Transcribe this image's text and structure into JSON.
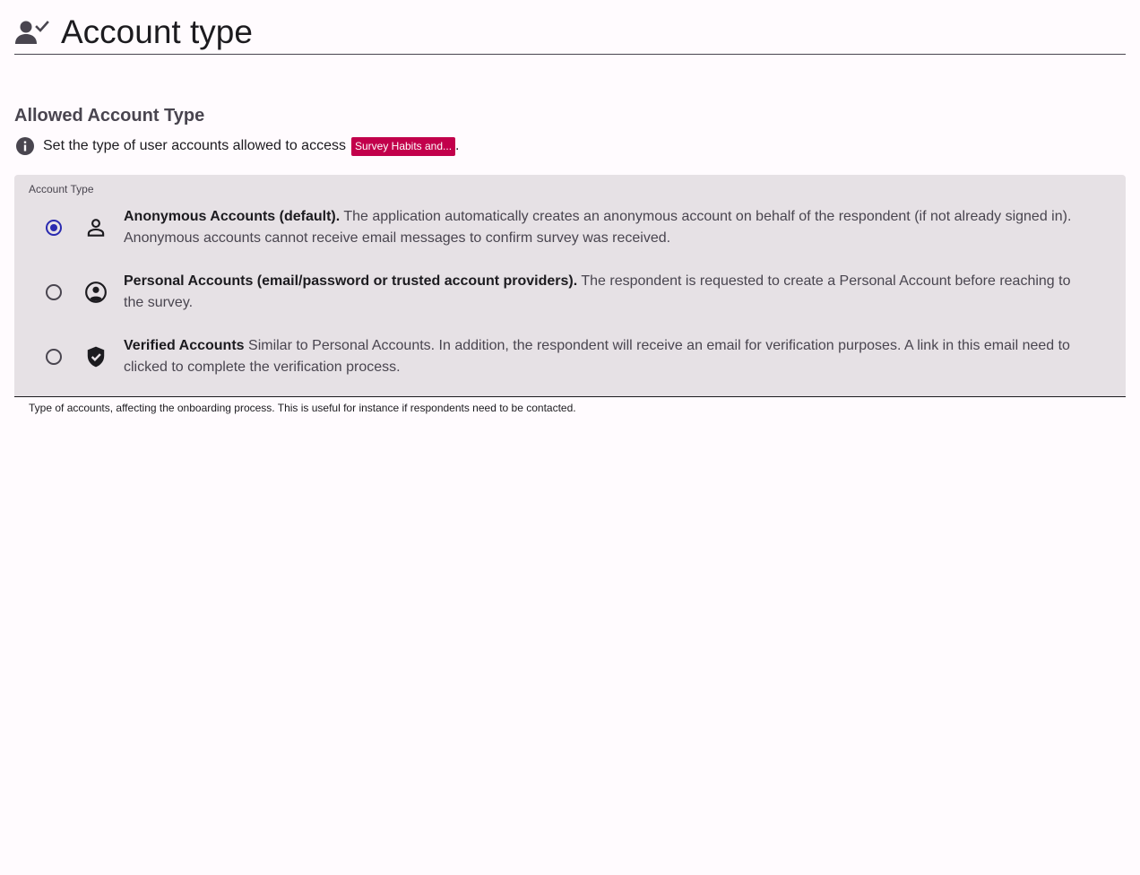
{
  "header": {
    "title": "Account type",
    "icon": "person-check-icon"
  },
  "section": {
    "title": "Allowed Account Type",
    "info_text": "Set the type of user accounts allowed to access",
    "survey_chip": "Survey Habits and...",
    "info_suffix": "."
  },
  "field": {
    "label": "Account Type",
    "helper": "Type of accounts, affecting the onboarding process. This is useful for instance if respondents need to be contacted.",
    "options": [
      {
        "title": "Anonymous Accounts (default).",
        "description": "The application automatically creates an anonymous account on behalf of the respondent (if not already signed in). Anonymous accounts cannot receive email messages to confirm survey was received.",
        "icon": "person-outline-icon",
        "selected": true
      },
      {
        "title": "Personal Accounts (email/password or trusted account providers).",
        "description": "The respondent is requested to create a Personal Account before reaching to the survey.",
        "icon": "account-circle-icon",
        "selected": false
      },
      {
        "title": "Verified Accounts",
        "description": "Similar to Personal Accounts. In addition, the respondent will receive an email for verification purposes. A link in this email need to clicked to complete the verification process.",
        "icon": "verified-shield-icon",
        "selected": false
      }
    ]
  },
  "colors": {
    "background": "#fffbfe",
    "field_background": "#e6e1e5",
    "chip": "#c2004b",
    "radio_selected": "#2a2ab0"
  }
}
